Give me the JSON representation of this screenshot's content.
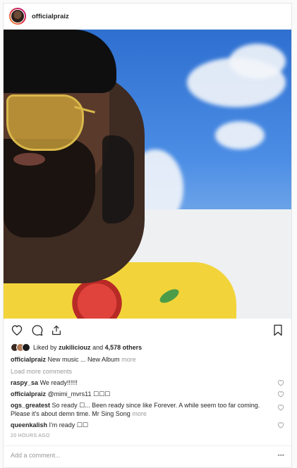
{
  "post": {
    "username": "officialpraiz",
    "liked_by_prefix": "Liked by",
    "liked_by_user": "zukiliciouz",
    "liked_by_and": "and",
    "likes_count": "4,578 others",
    "caption_user": "officialpraiz",
    "caption_text": "New music ... New Album",
    "caption_more": "more",
    "load_more": "Load more comments",
    "timestamp": "20 HOURS AGO",
    "add_comment_placeholder": "Add a comment...",
    "options_label": "•••"
  },
  "comments": [
    {
      "user": "raspy_sa",
      "text": "We ready!!!!!!"
    },
    {
      "user": "officialpraiz",
      "text": "@mimi_mvrs11 ☐☐☐"
    },
    {
      "user": "ogs_greatest",
      "text": "So ready ☐... Been ready since like Forever. A while seem too far coming. Please it's about demn time. Mr Sing Song",
      "more": "more"
    },
    {
      "user": "queenkalish",
      "text": "I'm ready ☐☐"
    }
  ],
  "icons": [
    "heart-icon",
    "comment-icon",
    "share-icon",
    "bookmark-icon"
  ],
  "colors": {
    "accent_gradient_start": "#f09433",
    "accent_gradient_end": "#bc1888",
    "muted": "#999999"
  }
}
